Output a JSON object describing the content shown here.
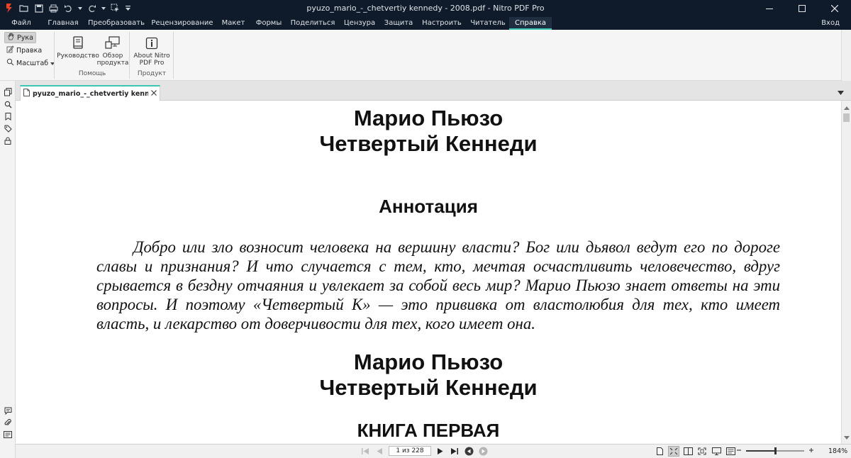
{
  "app": {
    "window_title": "pyuzo_mario_-_chetvertiy kennedy - 2008.pdf - Nitro PDF Pro",
    "brand_color": "#ef4123",
    "accent_color": "#3cc6b4"
  },
  "menu": {
    "items": [
      {
        "label": "Файл"
      },
      {
        "label": "Главная"
      },
      {
        "label": "Преобразовать"
      },
      {
        "label": "Рецензирование"
      },
      {
        "label": "Макет"
      },
      {
        "label": "Формы"
      },
      {
        "label": "Поделиться"
      },
      {
        "label": "Цензура"
      },
      {
        "label": "Защита"
      },
      {
        "label": "Настроить"
      },
      {
        "label": "Читатель"
      },
      {
        "label": "Справка",
        "active": true
      }
    ],
    "login_label": "Вход"
  },
  "ribbon": {
    "tools": {
      "hand": "Рука",
      "edit": "Правка",
      "zoom": "Масштаб"
    },
    "help_group": {
      "label": "Помощь",
      "guide": "Руководство",
      "tour_line1": "Обзор",
      "tour_line2": "продукта"
    },
    "product_group": {
      "label": "Продукт",
      "about_line1": "About Nitro",
      "about_line2": "PDF Pro"
    }
  },
  "document": {
    "tab_label": "pyuzo_mario_-_chetvertiy kennedy ...",
    "author": "Марио Пьюзо",
    "title": "Четвертый Кеннеди",
    "annotation_heading": "Аннотация",
    "annotation_text": "Добро или зло возносит человека на вершину власти? Бог или дьявол ведут его по дороге славы и признания? И что случается с тем, кто, мечтая осчастливить человечество, вдруг срывается в бездну отчаяния и увлекает за собой весь мир? Марио Пьюзо знает ответы на эти вопросы. И поэтому «Четвертый К» — это прививка от властолюбия для тех, кто имеет власть, и лекарство от доверчивости для тех, кого имеет она.",
    "book_heading": "КНИГА ПЕРВАЯ"
  },
  "status": {
    "page_indicator": "1 из 228",
    "zoom_label": "184%",
    "zoom_fraction": 0.5
  }
}
